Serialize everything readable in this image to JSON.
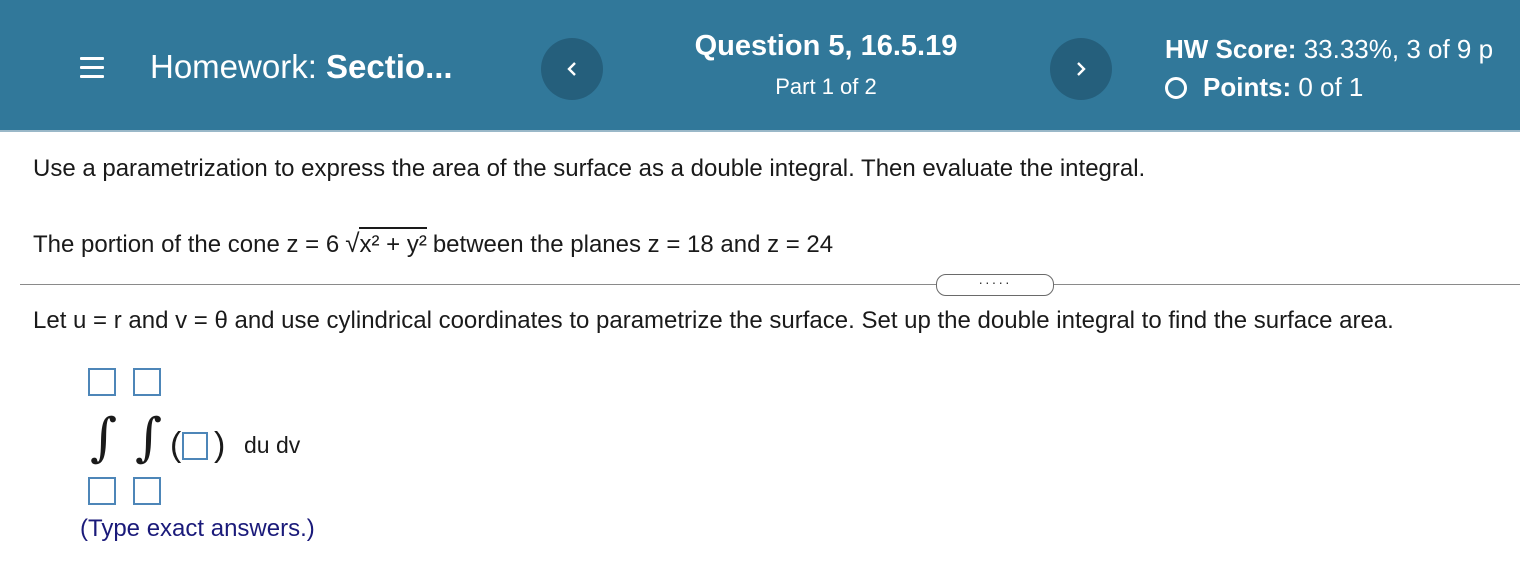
{
  "header": {
    "menu_icon": "hamburger-menu-icon",
    "homework_prefix": "Homework:",
    "homework_name": "Sectio...",
    "question_title": "Question 5, 16.5.19",
    "part": "Part 1 of 2",
    "hw_score_label": "HW Score:",
    "hw_score_value": "33.33%, 3 of 9 p",
    "points_label": "Points:",
    "points_value": "0 of 1",
    "prev_icon": "chevron-left-icon",
    "next_icon": "chevron-right-icon",
    "colors": {
      "bar": "#31789a",
      "button": "#255f7c"
    }
  },
  "problem": {
    "instruction": "Use a parametrization to express the area of the surface as a double integral. Then evaluate the integral.",
    "statement_prefix": "The portion of the cone z = 6",
    "radicand": "x² + y²",
    "statement_suffix": "between the planes z = 18 and z = 24",
    "expand_dots": "·····",
    "setup": "Let u = r and v = θ and use cylindrical coordinates to parametrize the surface. Set up the double integral to find the surface area.",
    "integral": {
      "sign": "∫",
      "differential": "du dv",
      "upper_limits": [
        "",
        ""
      ],
      "lower_limits": [
        "",
        ""
      ],
      "integrand": ""
    },
    "hint": "(Type exact answers.)"
  }
}
